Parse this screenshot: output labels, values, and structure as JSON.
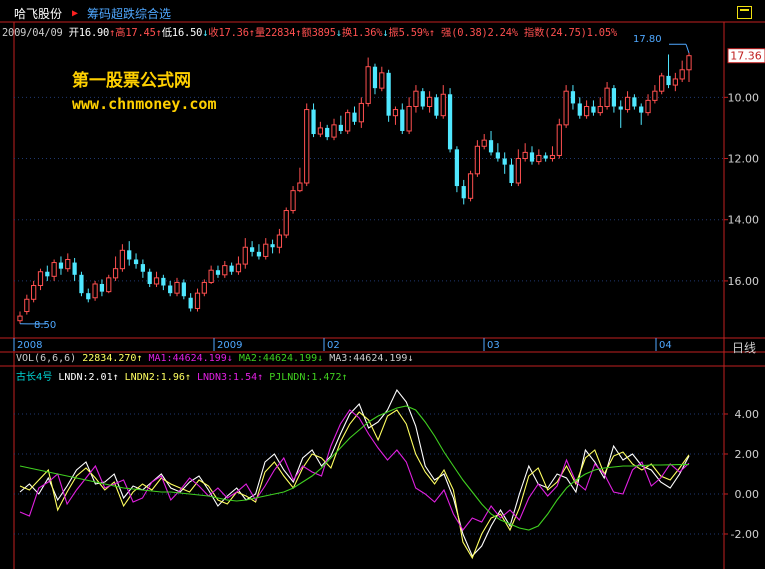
{
  "header": {
    "stock_name": "哈飞股份",
    "strategy_name": "筹码超跌综合选",
    "maximize_icon": "maximize-icon"
  },
  "quote": {
    "date": "2009/04/09",
    "open_label": "开",
    "open": "16.90",
    "high_label": "高",
    "high": "17.45",
    "low_label": "低",
    "low": "16.50",
    "close_label": "收",
    "close": "17.36",
    "volume_label": "量",
    "volume": "22834",
    "amount_label": "额",
    "amount": "3895",
    "turnover_label": "换",
    "turnover": "1.36%",
    "amplitude_label": "振",
    "amplitude": "5.59%",
    "strength_label": "强",
    "strength": "(0.38)2.24%",
    "index_label": "指数",
    "index": "(24.75)1.05%"
  },
  "watermark": {
    "line1": "第一股票公式网",
    "line2": "www.chnmoney.com"
  },
  "price_panel": {
    "y_ticks": [
      "16.00",
      "14.00",
      "12.00",
      "10.00"
    ],
    "current_price_tag": "17.36",
    "high_marker": "17.80",
    "low_marker": "8.50"
  },
  "time_axis": {
    "labels": [
      "2008",
      "2009",
      "02",
      "03",
      "04"
    ],
    "cycle": "日线"
  },
  "volume_row": {
    "title": "VOL(6,6,6)",
    "vol": "22834.270",
    "ma1": "MA1:44624.199",
    "ma2": "MA2:44624.199",
    "ma3": "MA3:44624.199"
  },
  "indicator": {
    "name": "古长4号",
    "lndn": "LNDN:2.01",
    "lndn2": "LNDN2:1.96",
    "lndn3": "LNDN3:1.54",
    "pjlndn": "PJLNDN:1.472",
    "y_ticks": [
      "4.00",
      "2.00",
      "0.00",
      "-2.00"
    ]
  },
  "colors": {
    "up": "#ff5050",
    "down": "#50e8ff",
    "panel_border": "#c02020",
    "grid": "#203870",
    "yellow": "#ffff60",
    "white_line": "#ffffff",
    "magenta": "#e020e0",
    "green": "#40d020",
    "cyan_text": "#00d8d8"
  },
  "chart_data": [
    {
      "type": "candlestick",
      "title": "",
      "ylim": [
        8.2,
        18.2
      ],
      "y_ticks": [
        10,
        12,
        14,
        16
      ],
      "candles": [
        [
          8.7,
          8.85,
          8.6,
          9.0
        ],
        [
          9.0,
          9.4,
          8.9,
          9.55
        ],
        [
          9.4,
          9.85,
          9.3,
          10.0
        ],
        [
          9.85,
          10.3,
          9.7,
          10.4
        ],
        [
          10.3,
          10.15,
          10.0,
          10.5
        ],
        [
          10.15,
          10.6,
          10.0,
          10.7
        ],
        [
          10.6,
          10.4,
          10.2,
          10.8
        ],
        [
          10.4,
          10.7,
          10.3,
          10.9
        ],
        [
          10.6,
          10.2,
          10.0,
          10.75
        ],
        [
          10.2,
          9.6,
          9.5,
          10.3
        ],
        [
          9.6,
          9.4,
          9.3,
          9.75
        ],
        [
          9.45,
          9.9,
          9.35,
          10.0
        ],
        [
          9.9,
          9.65,
          9.5,
          10.05
        ],
        [
          9.65,
          10.1,
          9.6,
          10.2
        ],
        [
          10.1,
          10.4,
          10.0,
          10.8
        ],
        [
          10.4,
          11.0,
          10.3,
          11.2
        ],
        [
          11.0,
          10.7,
          10.5,
          11.3
        ],
        [
          10.7,
          10.55,
          10.4,
          10.9
        ],
        [
          10.55,
          10.3,
          10.1,
          10.7
        ],
        [
          10.3,
          9.9,
          9.8,
          10.4
        ],
        [
          9.9,
          10.1,
          9.8,
          10.3
        ],
        [
          10.1,
          9.85,
          9.7,
          10.2
        ],
        [
          9.85,
          9.6,
          9.5,
          10.0
        ],
        [
          9.6,
          9.95,
          9.5,
          10.1
        ],
        [
          9.95,
          9.5,
          9.4,
          10.05
        ],
        [
          9.45,
          9.1,
          9.0,
          9.6
        ],
        [
          9.1,
          9.6,
          9.0,
          9.75
        ],
        [
          9.6,
          9.95,
          9.5,
          10.05
        ],
        [
          9.95,
          10.35,
          9.9,
          10.5
        ],
        [
          10.35,
          10.2,
          10.1,
          10.5
        ],
        [
          10.2,
          10.5,
          10.1,
          10.65
        ],
        [
          10.5,
          10.3,
          10.2,
          10.6
        ],
        [
          10.3,
          10.55,
          10.2,
          10.8
        ],
        [
          10.55,
          11.1,
          10.4,
          11.4
        ],
        [
          11.1,
          10.95,
          10.8,
          11.3
        ],
        [
          10.95,
          10.8,
          10.7,
          11.2
        ],
        [
          10.8,
          11.2,
          10.7,
          11.4
        ],
        [
          11.2,
          11.1,
          10.9,
          11.35
        ],
        [
          11.1,
          11.5,
          10.9,
          11.7
        ],
        [
          11.5,
          12.3,
          11.4,
          12.4
        ],
        [
          12.3,
          12.95,
          12.2,
          13.1
        ],
        [
          12.95,
          13.2,
          12.9,
          13.7
        ],
        [
          13.2,
          15.6,
          13.1,
          15.8
        ],
        [
          15.6,
          14.8,
          14.7,
          15.8
        ],
        [
          14.8,
          15.0,
          14.7,
          15.2
        ],
        [
          15.0,
          14.7,
          14.6,
          15.1
        ],
        [
          14.7,
          15.1,
          14.6,
          15.3
        ],
        [
          15.1,
          14.9,
          14.8,
          15.4
        ],
        [
          14.9,
          15.5,
          14.8,
          15.6
        ],
        [
          15.5,
          15.2,
          15.1,
          15.7
        ],
        [
          15.2,
          15.8,
          15.0,
          16.0
        ],
        [
          15.8,
          17.0,
          15.7,
          17.3
        ],
        [
          17.0,
          16.3,
          16.1,
          17.1
        ],
        [
          16.3,
          16.8,
          16.2,
          17.0
        ],
        [
          16.8,
          15.4,
          15.2,
          16.9
        ],
        [
          15.4,
          15.6,
          15.1,
          15.7
        ],
        [
          15.6,
          14.9,
          14.8,
          15.8
        ],
        [
          14.9,
          15.7,
          14.8,
          16.0
        ],
        [
          15.7,
          16.2,
          15.5,
          16.4
        ],
        [
          16.2,
          15.7,
          15.6,
          16.3
        ],
        [
          15.7,
          16.0,
          15.5,
          16.2
        ],
        [
          16.0,
          15.4,
          15.3,
          16.1
        ],
        [
          15.4,
          16.1,
          15.3,
          16.4
        ],
        [
          16.1,
          14.3,
          14.2,
          16.3
        ],
        [
          14.3,
          13.1,
          12.9,
          14.4
        ],
        [
          13.1,
          12.7,
          12.5,
          13.3
        ],
        [
          12.7,
          13.5,
          12.6,
          13.6
        ],
        [
          13.5,
          14.4,
          13.4,
          14.6
        ],
        [
          14.4,
          14.6,
          14.3,
          14.8
        ],
        [
          14.6,
          14.2,
          14.1,
          14.9
        ],
        [
          14.2,
          14.0,
          13.9,
          14.5
        ],
        [
          14.0,
          13.8,
          13.5,
          14.2
        ],
        [
          13.8,
          13.2,
          13.1,
          14.0
        ],
        [
          13.2,
          14.0,
          13.1,
          14.3
        ],
        [
          14.0,
          14.2,
          13.9,
          14.5
        ],
        [
          14.2,
          13.9,
          13.8,
          14.4
        ],
        [
          13.9,
          14.1,
          13.8,
          14.3
        ],
        [
          14.1,
          14.0,
          13.9,
          14.2
        ],
        [
          14.0,
          14.1,
          13.9,
          14.4
        ],
        [
          14.1,
          15.1,
          14.0,
          15.3
        ],
        [
          15.1,
          16.2,
          15.0,
          16.4
        ],
        [
          16.2,
          15.8,
          15.6,
          16.4
        ],
        [
          15.8,
          15.4,
          15.3,
          16.0
        ],
        [
          15.4,
          15.7,
          15.3,
          15.9
        ],
        [
          15.7,
          15.5,
          15.4,
          15.9
        ],
        [
          15.5,
          15.7,
          15.4,
          16.0
        ],
        [
          15.7,
          16.3,
          15.6,
          16.5
        ],
        [
          16.3,
          15.7,
          15.5,
          16.4
        ],
        [
          15.7,
          15.6,
          15.0,
          15.9
        ],
        [
          15.6,
          16.0,
          15.5,
          16.2
        ],
        [
          16.0,
          15.7,
          15.6,
          16.1
        ],
        [
          15.7,
          15.5,
          15.1,
          15.8
        ],
        [
          15.5,
          15.9,
          15.4,
          16.1
        ],
        [
          15.9,
          16.2,
          15.8,
          16.4
        ],
        [
          16.2,
          16.7,
          16.1,
          16.8
        ],
        [
          16.7,
          16.4,
          16.3,
          17.4
        ],
        [
          16.4,
          16.6,
          16.2,
          16.8
        ],
        [
          16.6,
          16.9,
          16.5,
          17.2
        ],
        [
          16.9,
          17.36,
          16.5,
          17.45
        ]
      ],
      "high": 17.8,
      "low": 8.5
    },
    {
      "type": "line",
      "title": "",
      "ylim": [
        -3.3,
        5.6
      ],
      "y_ticks": [
        4,
        2,
        0,
        -2
      ],
      "series": [
        {
          "name": "LNDN",
          "color": "#ffffff",
          "values": [
            0.1,
            0.5,
            0.0,
            0.8,
            -0.3,
            0.4,
            1.2,
            1.6,
            0.5,
            0.6,
            1.0,
            -0.2,
            0.4,
            0.2,
            0.6,
            1.0,
            0.3,
            0.1,
            0.6,
            0.9,
            0.2,
            -0.6,
            -0.1,
            0.3,
            -0.3,
            0.0,
            1.6,
            2.0,
            1.2,
            0.6,
            1.8,
            2.2,
            1.4,
            1.9,
            3.0,
            4.0,
            4.5,
            3.3,
            3.6,
            4.2,
            5.2,
            4.6,
            3.4,
            1.4,
            0.7,
            1.0,
            -0.2,
            -2.0,
            -3.1,
            -2.6,
            -1.6,
            -0.8,
            -1.6,
            0.0,
            1.4,
            0.5,
            0.3,
            1.0,
            0.8,
            0.1,
            2.2,
            1.6,
            0.8,
            2.4,
            1.7,
            2.0,
            1.4,
            1.2,
            0.6,
            0.3,
            1.0,
            1.9
          ]
        },
        {
          "name": "LNDN2",
          "color": "#ffff60",
          "values": [
            0.4,
            0.2,
            0.7,
            1.2,
            -0.8,
            0.1,
            0.9,
            1.3,
            0.8,
            0.2,
            0.6,
            -0.6,
            0.1,
            0.5,
            0.2,
            0.8,
            0.5,
            0.3,
            0.1,
            0.7,
            0.4,
            -0.3,
            -0.5,
            0.1,
            -0.1,
            -0.4,
            1.1,
            1.6,
            0.9,
            0.3,
            1.3,
            2.0,
            1.8,
            1.3,
            2.6,
            3.5,
            4.1,
            3.7,
            2.7,
            3.9,
            4.2,
            3.5,
            2.0,
            1.1,
            0.5,
            1.2,
            0.2,
            -2.4,
            -3.2,
            -2.0,
            -1.2,
            -1.0,
            -1.8,
            -0.7,
            0.9,
            1.3,
            0.2,
            0.6,
            1.4,
            0.5,
            1.8,
            2.2,
            1.0,
            1.9,
            2.1,
            1.5,
            1.2,
            1.5,
            0.9,
            0.7,
            1.3,
            1.96
          ]
        },
        {
          "name": "LNDN3",
          "color": "#e020e0",
          "values": [
            -0.9,
            -1.1,
            0.3,
            0.6,
            1.0,
            -0.5,
            0.2,
            0.8,
            1.4,
            0.3,
            0.5,
            0.7,
            -0.4,
            -0.2,
            0.6,
            0.9,
            -0.3,
            0.2,
            0.8,
            0.4,
            -0.1,
            0.3,
            -0.2,
            0.1,
            0.5,
            -0.3,
            0.4,
            1.2,
            1.8,
            0.7,
            1.4,
            1.1,
            0.9,
            2.4,
            3.5,
            4.2,
            3.8,
            3.0,
            2.3,
            1.7,
            2.2,
            1.6,
            0.3,
            0.0,
            -0.4,
            0.2,
            -1.0,
            -1.8,
            -1.2,
            -1.4,
            -0.6,
            -1.2,
            -0.8,
            -1.3,
            -0.2,
            0.5,
            -0.1,
            0.4,
            1.7,
            0.6,
            0.2,
            1.5,
            1.0,
            0.1,
            0.0,
            1.2,
            1.6,
            0.4,
            0.8,
            1.5,
            1.1,
            1.54
          ]
        },
        {
          "name": "PJLNDN",
          "color": "#40d020",
          "values": [
            1.4,
            1.3,
            1.2,
            1.1,
            1.0,
            0.9,
            0.8,
            0.7,
            0.6,
            0.5,
            0.4,
            0.3,
            0.25,
            0.2,
            0.15,
            0.1,
            0.1,
            0.05,
            0.0,
            -0.05,
            -0.1,
            -0.2,
            -0.3,
            -0.35,
            -0.3,
            -0.2,
            -0.1,
            0.0,
            0.1,
            0.3,
            0.6,
            0.9,
            1.3,
            1.8,
            2.3,
            2.8,
            3.2,
            3.6,
            3.9,
            4.1,
            4.3,
            4.4,
            4.2,
            3.6,
            2.9,
            2.1,
            1.4,
            0.7,
            0.1,
            -0.5,
            -1.0,
            -1.3,
            -1.5,
            -1.7,
            -1.8,
            -1.6,
            -1.0,
            -0.3,
            0.3,
            0.7,
            1.0,
            1.2,
            1.3,
            1.35,
            1.4,
            1.4,
            1.42,
            1.45,
            1.45,
            1.46,
            1.47,
            1.472
          ]
        }
      ]
    }
  ]
}
